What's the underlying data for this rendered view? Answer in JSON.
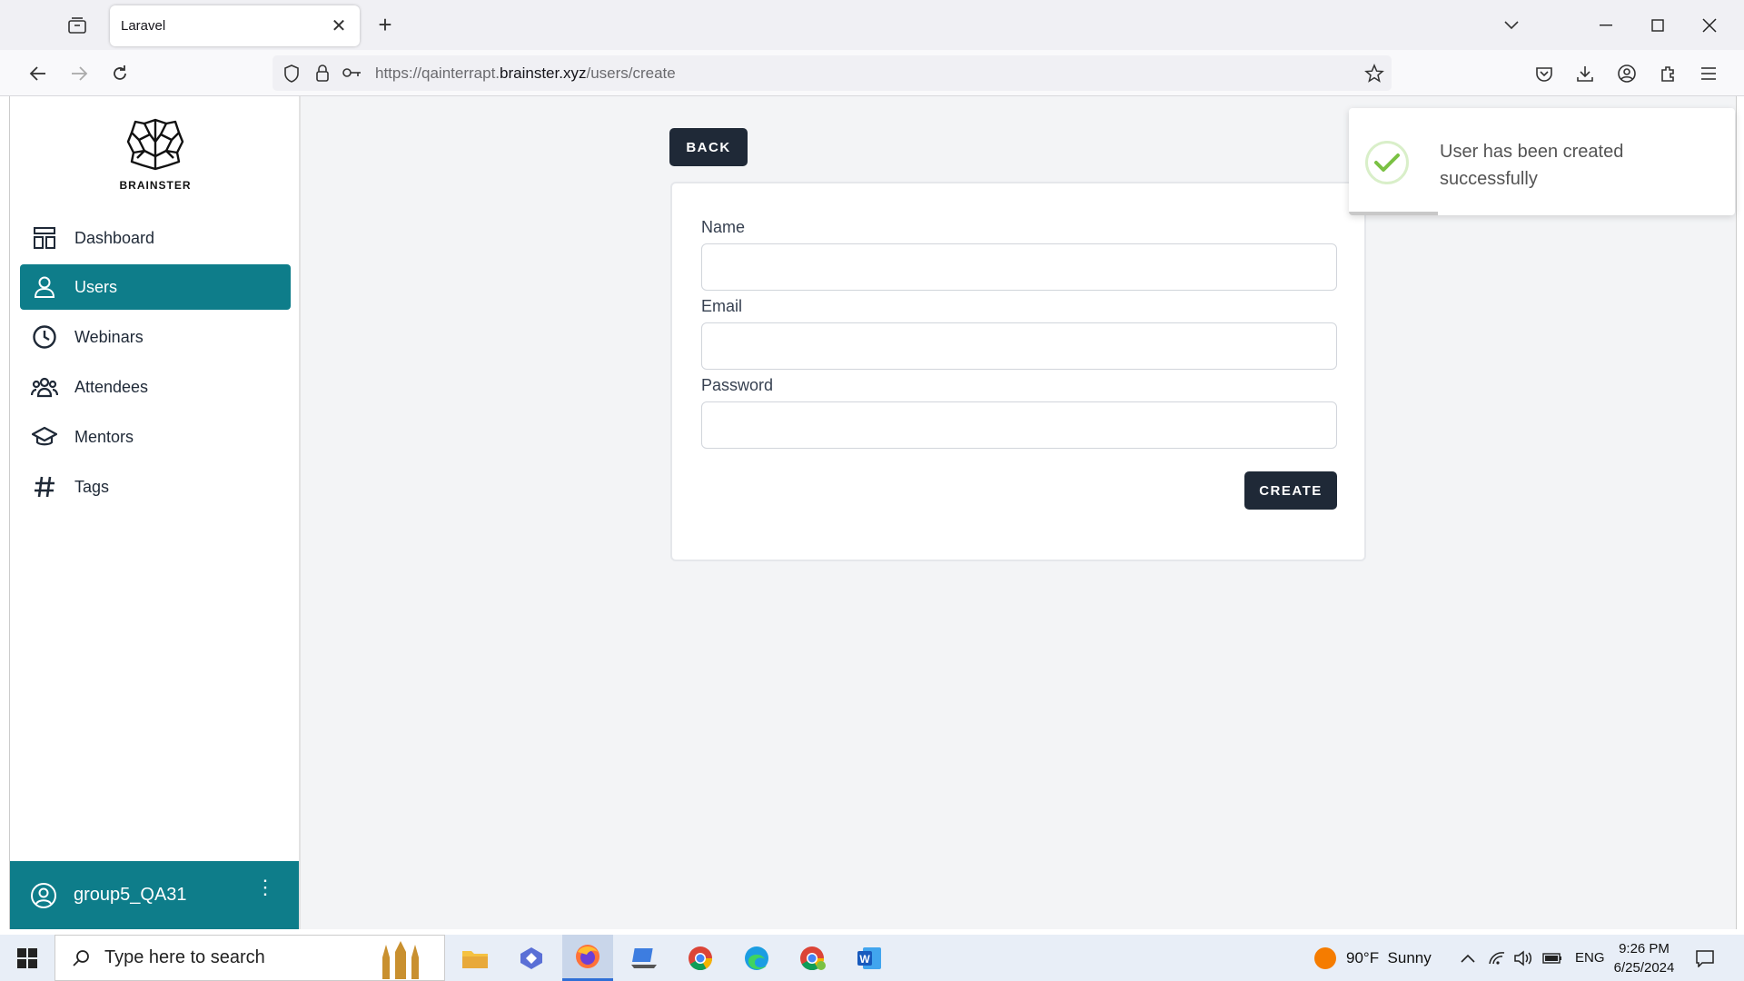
{
  "browser": {
    "tab_title": "Laravel",
    "url_prefix": "https://qainterrapt.",
    "url_domain": "brainster.xyz",
    "url_path": "/users/create"
  },
  "sidebar": {
    "logo_text": "BRAINSTER",
    "items": [
      {
        "label": "Dashboard",
        "icon": "dashboard-icon",
        "active": false
      },
      {
        "label": "Users",
        "icon": "user-icon",
        "active": true
      },
      {
        "label": "Webinars",
        "icon": "clock-icon",
        "active": false
      },
      {
        "label": "Attendees",
        "icon": "people-icon",
        "active": false
      },
      {
        "label": "Mentors",
        "icon": "graduation-cap-icon",
        "active": false
      },
      {
        "label": "Tags",
        "icon": "hashtag-icon",
        "active": false
      }
    ],
    "user_name": "group5_QA31"
  },
  "main": {
    "back_label": "BACK",
    "form": {
      "name_label": "Name",
      "name_value": "",
      "email_label": "Email",
      "email_value": "",
      "password_label": "Password",
      "password_value": "",
      "create_label": "CREATE"
    }
  },
  "toast": {
    "message": "User has been created successfully",
    "progress_fraction": 0.23
  },
  "taskbar": {
    "search_placeholder": "Type here to search",
    "weather": "90°F  Sunny",
    "language": "ENG",
    "time": "9:26 PM",
    "date": "6/25/2024"
  },
  "colors": {
    "accent": "#0e7d8a",
    "dark_button": "#1f2937",
    "success": "#7ac143"
  }
}
